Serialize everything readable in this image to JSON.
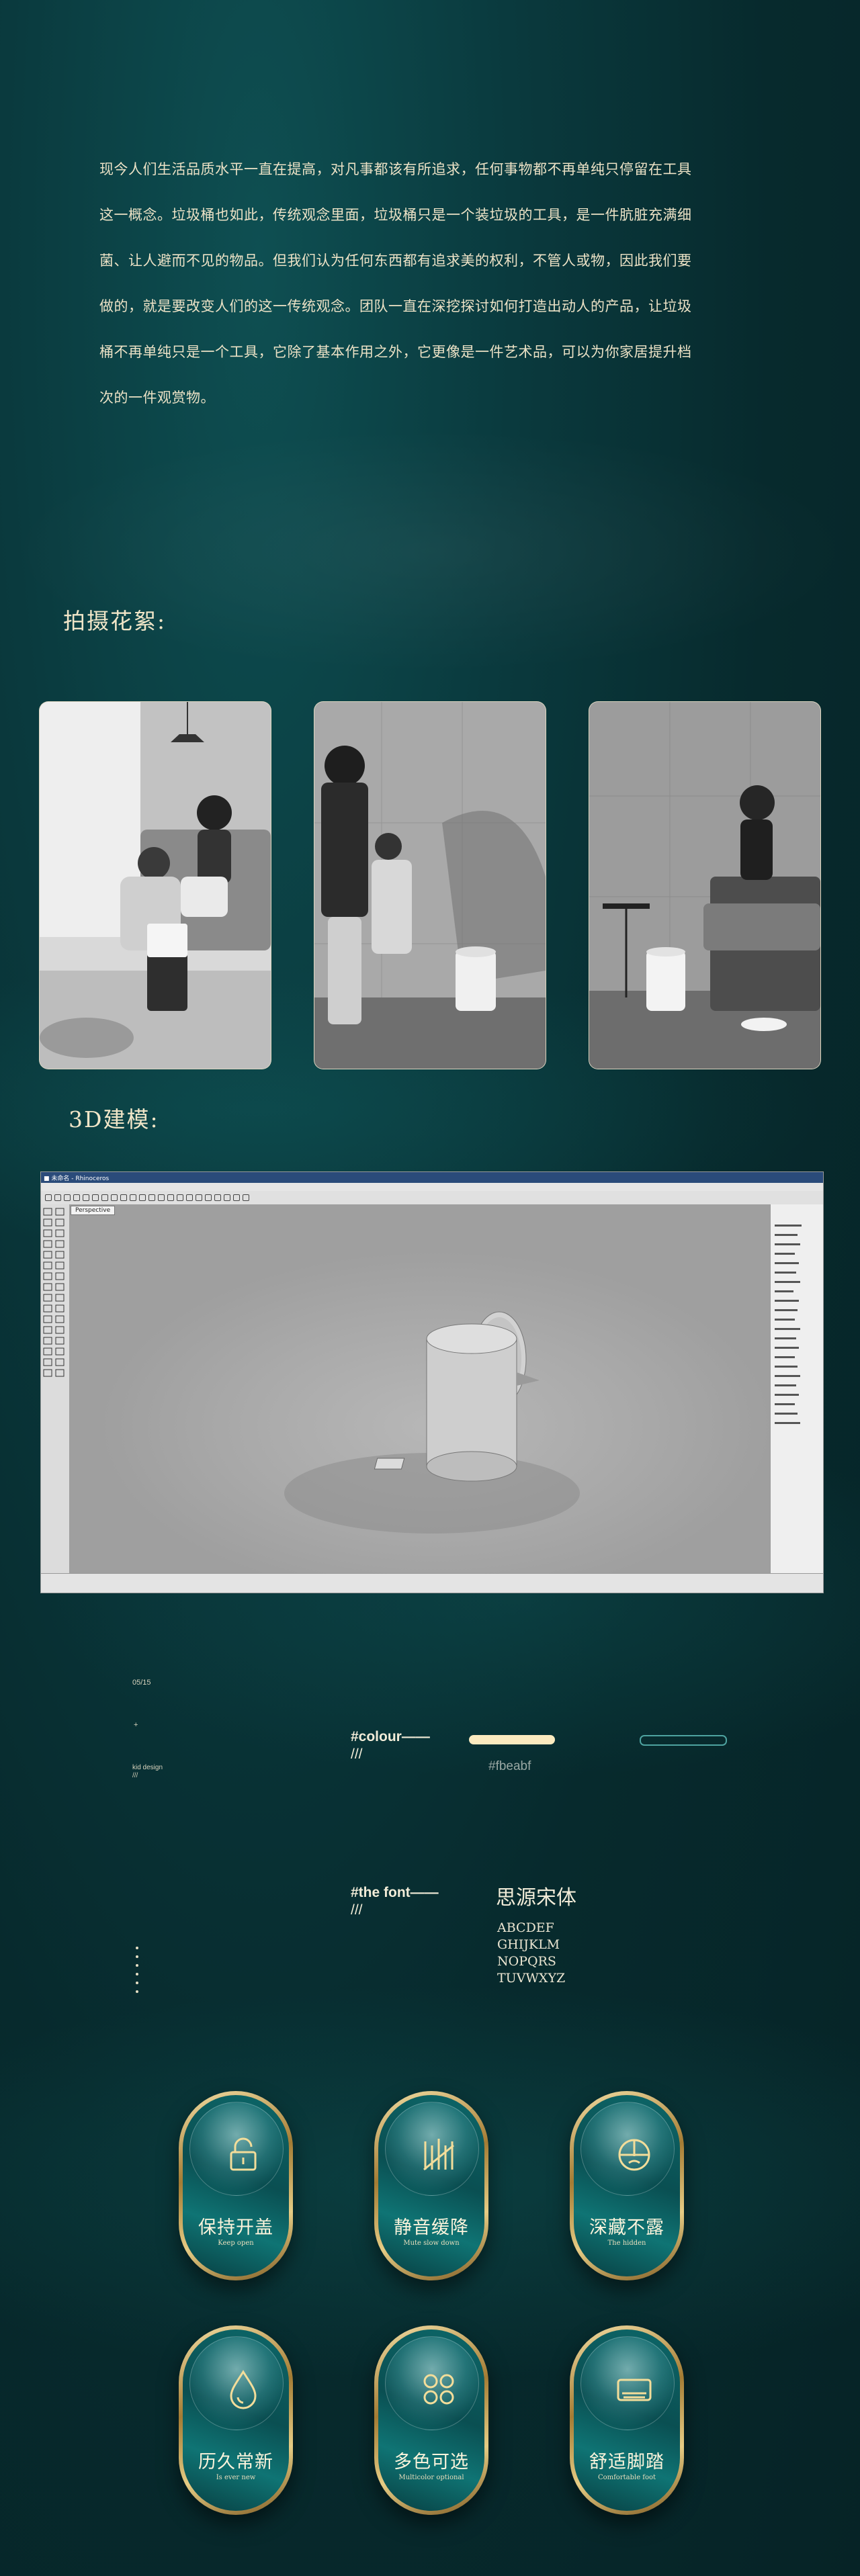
{
  "intro": {
    "lines": [
      "现今人们生活品质水平一直在提高，对凡事都该有所追求，任何事物都不再单纯只停留在工具",
      "这一概念。垃圾桶也如此，传统观念里面，垃圾桶只是一个装垃圾的工具，是一件肮脏充满细",
      "菌、让人避而不见的物品。但我们认为任何东西都有追求美的权利，不管人或物，因此我们要",
      "做的，就是要改变人们的这一传统观念。团队一直在深挖探讨如何打造出动人的产品，让垃圾",
      "桶不再单纯只是一个工具，它除了基本作用之外，它更像是一件艺术品，可以为你家居提升档",
      "次的一件观赏物。"
    ]
  },
  "sections": {
    "shoot_title": "拍摄花絮:",
    "model_title": "3D建模:"
  },
  "cad": {
    "window_title": "■ 未命名 - Rhinoceros",
    "view_tab": "Perspective"
  },
  "style_info": {
    "date": "05/15",
    "mark": "+",
    "kid_design": "kid design",
    "slashes": "///",
    "colour_label": "#colour——",
    "colour_slashes": "///",
    "colour_hex": "#fbeabf",
    "font_label": "#the font——",
    "font_slashes": "///",
    "font_name": "思源宋体",
    "alphabet": [
      "ABCDEF",
      "GHIJKLM",
      "NOPQRS",
      "TUVWXYZ"
    ]
  },
  "colors": {
    "accent": "#fbeabf",
    "teal": "#0a4f52"
  },
  "features": [
    {
      "title": "保持开盖",
      "subtitle": "Keep open",
      "icon": "lock-icon"
    },
    {
      "title": "静音缓降",
      "subtitle": "Mute slow down",
      "icon": "damper-icon"
    },
    {
      "title": "深藏不露",
      "subtitle": "The hidden",
      "icon": "concealed-icon"
    },
    {
      "title": "历久常新",
      "subtitle": "Is ever new",
      "icon": "droplet-icon"
    },
    {
      "title": "多色可选",
      "subtitle": "Multicolor optional",
      "icon": "palette-icon"
    },
    {
      "title": "舒适脚踏",
      "subtitle": "Comfortable foot",
      "icon": "pedal-icon"
    }
  ]
}
